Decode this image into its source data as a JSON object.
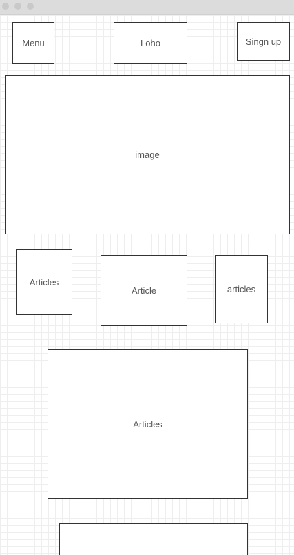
{
  "header": {
    "menu_label": "Menu",
    "logo_label": "Loho",
    "signup_label": "Singn up"
  },
  "hero": {
    "image_label": "image"
  },
  "articles_row": {
    "left_label": "Articles",
    "center_label": "Article",
    "right_label": "articles"
  },
  "featured": {
    "label": "Articles"
  },
  "footer_block": {
    "label": ""
  }
}
